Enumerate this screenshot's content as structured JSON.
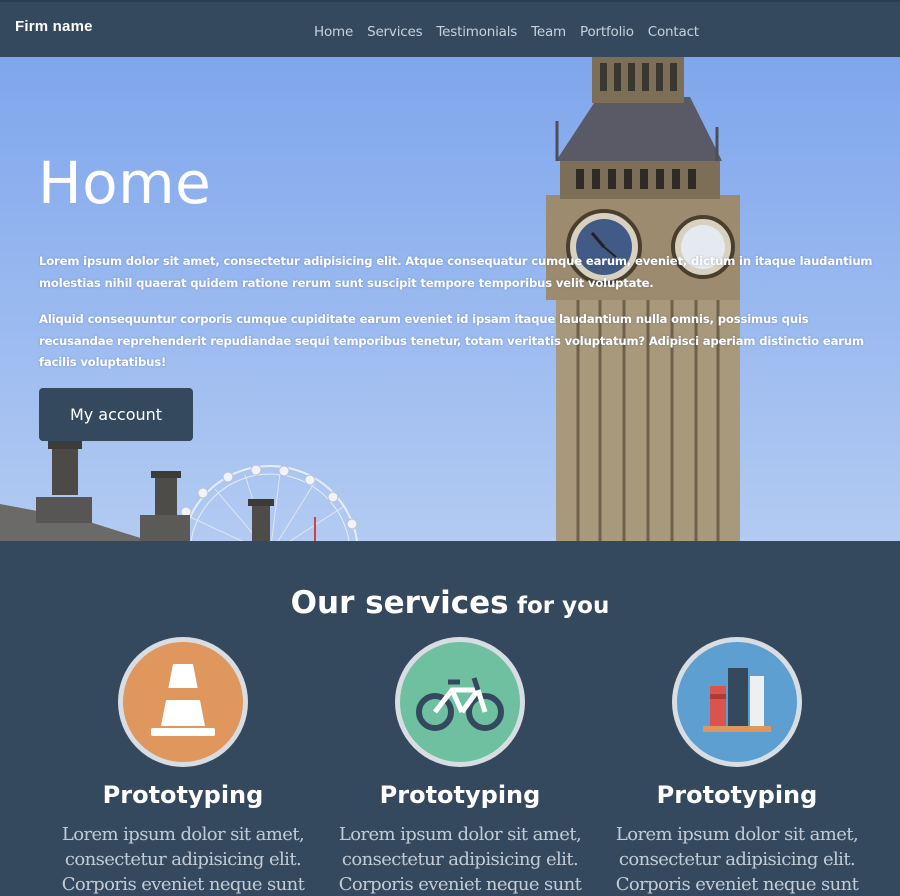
{
  "navbar": {
    "brand": "Firm name",
    "links": [
      "Home",
      "Services",
      "Testimonials",
      "Team",
      "Portfolio",
      "Contact"
    ]
  },
  "hero": {
    "title": "Home",
    "paragraph1": "Lorem ipsum dolor sit amet, consectetur adipisicing elit. Atque consequatur cumque earum, eveniet, dictum in itaque laudantium molestias nihil quaerat quidem ratione rerum sunt suscipit tempore temporibus velit voluptate.",
    "paragraph2": "Aliquid consequuntur corporis cumque cupiditate earum eveniet id ipsam itaque laudantium nulla omnis, possimus quis recusandae reprehenderit repudiandae sequi temporibus tenetur, totam veritatis voluptatum? Adipisci aperiam distinctio earum facilis voluptatibus!",
    "button_label": "My account"
  },
  "services": {
    "title_main": "Our services",
    "title_sub": "for you",
    "items": [
      {
        "icon": "traffic-cone-icon",
        "title": "Prototyping",
        "text": "Lorem ipsum dolor sit amet, consectetur adipisicing elit. Corporis eveniet neque sunt"
      },
      {
        "icon": "bicycle-icon",
        "title": "Prototyping",
        "text": "Lorem ipsum dolor sit amet, consectetur adipisicing elit. Corporis eveniet neque sunt"
      },
      {
        "icon": "books-icon",
        "title": "Prototyping",
        "text": "Lorem ipsum dolor sit amet, consectetur adipisicing elit. Corporis eveniet neque sunt"
      }
    ]
  },
  "colors": {
    "primary": "#34495e",
    "sky": "#8fb2ee",
    "icon_orange": "#e0975e",
    "icon_green": "#6fc0a0",
    "icon_blue": "#5d9fd1"
  }
}
